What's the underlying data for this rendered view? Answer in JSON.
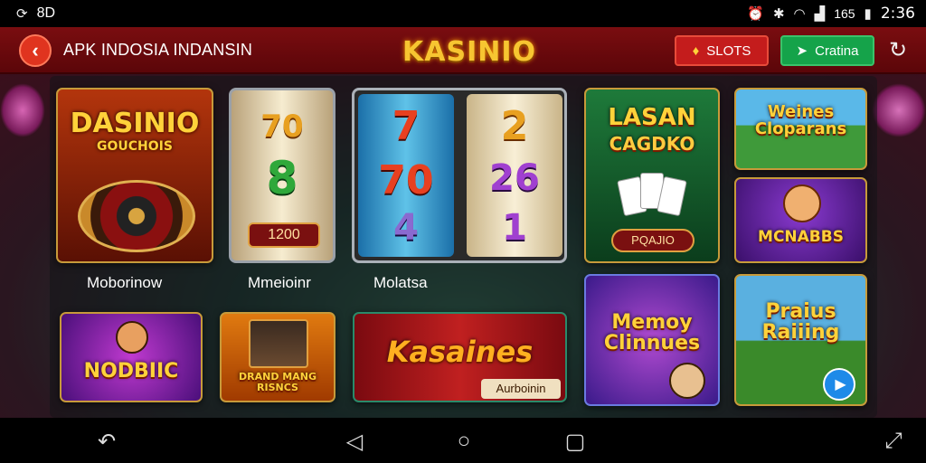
{
  "status_bar": {
    "left_text": "8D",
    "battery_text": "165",
    "time": "2:36"
  },
  "header": {
    "title": "APK INDOSIA INDANSIN",
    "brand": "KASINIO",
    "slots_label": "SLOTS",
    "share_label": "Cratina"
  },
  "tiles": {
    "roulette_title": "DASINIO",
    "roulette_subtitle": "GOUCHOIS",
    "roulette_caption": "Moborinow",
    "reel_price": "1200",
    "reel1_symbols": [
      "70",
      "8"
    ],
    "reel1_caption": "Mmeioinr",
    "reel2_symbols": [
      "7",
      "70",
      "4"
    ],
    "reel3_symbols": [
      "2",
      "26",
      "1"
    ],
    "reels_caption": "Molatsa",
    "lasan_title": "LASAN",
    "lasan_subtitle": "CAGDKO",
    "lasan_button": "PQAJIO",
    "weines_title": "Weines Cloparans",
    "mcnabbs_title": "MCNABBS",
    "nodbiic_title": "NODBIIC",
    "slots_man_title": "DRAND MANG RISNCS",
    "kasaines_title": "Kasaines",
    "kasaines_sub": "Aurboinin",
    "memory_title": "Memoy Clinnues",
    "praius_title": "Praius Raiiing"
  },
  "colors": {
    "header_bg": "#6b0a0d",
    "brand_gold": "#f7c531",
    "slots_red": "#c41c1c",
    "share_green": "#15a34a"
  },
  "icons": {
    "back": "chevron-left-icon",
    "slots": "coins-icon",
    "share": "share-arrow-icon",
    "refresh": "refresh-icon",
    "play": "play-icon",
    "nav_back": "nav-back-icon",
    "nav_home": "nav-home-icon",
    "nav_recents": "nav-recents-icon",
    "expand": "expand-icon"
  }
}
